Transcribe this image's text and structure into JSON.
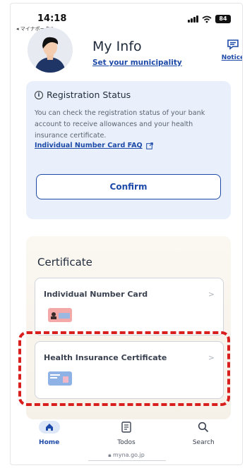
{
  "status_bar": {
    "time": "14:18",
    "back_app": "◂ マイナポータル",
    "battery": "84"
  },
  "header": {
    "title": "My Info",
    "municipality_link": "Set your municipality",
    "notice_label": "Notice"
  },
  "registration": {
    "title": "Registration Status",
    "description": "You can check the registration status of your bank account to receive allowances and your health insurance certificate.",
    "faq_link": "Individual Number Card FAQ",
    "confirm_label": "Confirm"
  },
  "certificate": {
    "heading": "Certificate",
    "items": [
      {
        "label": "Individual Number Card",
        "chevron": ">"
      },
      {
        "label": "Health Insurance Certificate",
        "chevron": ">"
      }
    ]
  },
  "nav": {
    "items": [
      {
        "label": "Home",
        "icon": "home-icon",
        "active": true
      },
      {
        "label": "Todos",
        "icon": "todos-icon",
        "active": false
      },
      {
        "label": "Search",
        "icon": "search-icon",
        "active": false
      }
    ]
  },
  "url": "myna.go.jp",
  "colors": {
    "accent": "#1d4aa8",
    "highlight": "#d91e1e",
    "info_card": "#e9f0fb"
  }
}
